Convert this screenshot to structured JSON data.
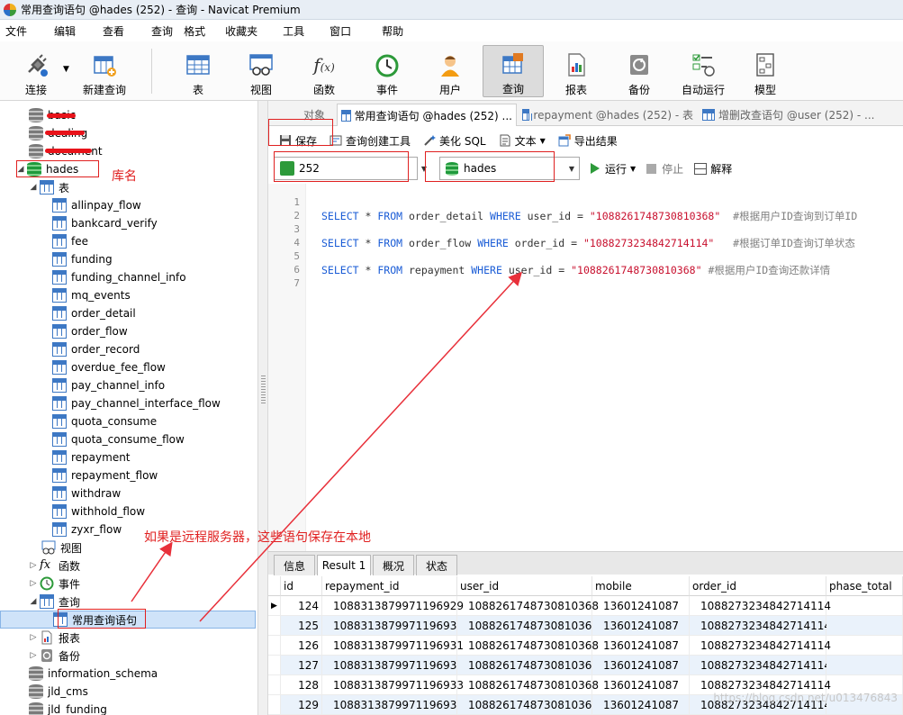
{
  "window": {
    "title": "常用查询语句 @hades (252) - 查询 - Navicat Premium"
  },
  "menu": [
    "文件",
    "编辑",
    "查看",
    "查询",
    "格式",
    "收藏夹",
    "工具",
    "窗口",
    "帮助"
  ],
  "toolbar": {
    "connect": "连接",
    "new_query": "新建查询",
    "table": "表",
    "view": "视图",
    "function": "函数",
    "event": "事件",
    "user": "用户",
    "query": "查询",
    "report": "报表",
    "backup": "备份",
    "schedule": "自动运行",
    "model": "模型"
  },
  "sidebar": {
    "top_dbs": [
      "basic",
      "dealing",
      "document"
    ],
    "db_name": "hades",
    "db_annotation": "库名",
    "tables_label": "表",
    "tables": [
      "allinpay_flow",
      "bankcard_verify",
      "fee",
      "funding",
      "funding_channel_info",
      "mq_events",
      "order_detail",
      "order_flow",
      "order_record",
      "overdue_fee_flow",
      "pay_channel_info",
      "pay_channel_interface_flow",
      "quota_consume",
      "quota_consume_flow",
      "repayment",
      "repayment_flow",
      "withdraw",
      "withhold_flow",
      "zyxr_flow"
    ],
    "views_label": "视图",
    "functions_label": "函数",
    "events_label": "事件",
    "queries_label": "查询",
    "saved_query": "常用查询语句",
    "reports_label": "报表",
    "backups_label": "备份",
    "other_dbs": [
      "information_schema",
      "jld_cms",
      "jld_funding"
    ]
  },
  "tabs": {
    "objects": "对象",
    "active": "常用查询语句 @hades (252) ...",
    "tab3": "repayment @hades (252) - 表",
    "tab4": "增删改查语句 @user (252) - ..."
  },
  "query_toolbar": {
    "save": "保存",
    "builder": "查询创建工具",
    "beautify": "美化 SQL",
    "text": "文本",
    "export": "导出结果"
  },
  "selectors": {
    "connection": "252",
    "database": "hades",
    "run": "运行",
    "stop": "停止",
    "explain": "解释"
  },
  "editor": {
    "line_numbers": [
      "1",
      "2",
      "3",
      "4",
      "5",
      "6",
      "7"
    ],
    "lines": [
      {
        "sel": "SELECT",
        "star": "*",
        "from": "FROM",
        "table": "order_detail",
        "where": "WHERE",
        "col": "user_id",
        "eq": "=",
        "val": "\"1088261748730810368\"",
        "comment": "#根据用户ID查询到订单ID"
      },
      {
        "sel": "SELECT",
        "star": "*",
        "from": "FROM",
        "table": "order_flow",
        "where": "WHERE",
        "col": "order_id",
        "eq": "=",
        "val": "\"1088273234842714114\"",
        "comment": "#根据订单ID查询订单状态"
      },
      {
        "sel": "SELECT",
        "star": "*",
        "from": "FROM",
        "table": "repayment",
        "where": "WHERE",
        "col": "user_id",
        "eq": "=",
        "val": "\"1088261748730810368\"",
        "comment": "#根据用户ID查询还款详情"
      }
    ]
  },
  "annotation_remote": "如果是远程服务器，这些语句保存在本地",
  "result_tabs": [
    "信息",
    "Result 1",
    "概况",
    "状态"
  ],
  "grid": {
    "columns": [
      "id",
      "repayment_id",
      "user_id",
      "mobile",
      "order_id",
      "phase_total"
    ],
    "rows": [
      [
        "124",
        "1088313879971196929",
        "1088261748730810368",
        "13601241087",
        "1088273234842714114",
        ""
      ],
      [
        "125",
        "1088313879971196930",
        "1088261748730810368",
        "13601241087",
        "1088273234842714114",
        ""
      ],
      [
        "126",
        "1088313879971196931",
        "1088261748730810368",
        "13601241087",
        "1088273234842714114",
        ""
      ],
      [
        "127",
        "1088313879971196932",
        "1088261748730810368",
        "13601241087",
        "1088273234842714114",
        ""
      ],
      [
        "128",
        "1088313879971196933",
        "1088261748730810368",
        "13601241087",
        "1088273234842714114",
        ""
      ],
      [
        "129",
        "1088313879971196934",
        "1088261748730810368",
        "13601241087",
        "1088273234842714114",
        ""
      ]
    ]
  },
  "watermark": "https://blog.csdn.net/u013476843",
  "colors": {
    "annotation_red": "#e02020",
    "keyword_blue": "#1a5cd6",
    "string_red": "#c8102e",
    "db_green": "#1f9a3c"
  }
}
